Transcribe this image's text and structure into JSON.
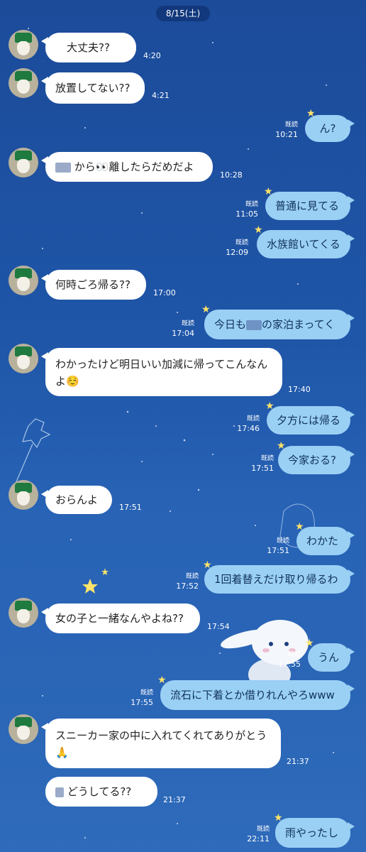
{
  "date": "8/15(土)",
  "read_label": "既読",
  "messages": [
    {
      "side": "in",
      "text": "大丈夫??",
      "time": "4:20"
    },
    {
      "side": "in",
      "text": "放置してない??",
      "time": "4:21"
    },
    {
      "side": "out",
      "text": "ん?",
      "time": "10:21"
    },
    {
      "side": "in",
      "text": "から👀離したらだめだよ",
      "time": "10:28"
    },
    {
      "side": "out",
      "text": "普通に見てる",
      "time": "11:05"
    },
    {
      "side": "out",
      "text": "水族館いてくる",
      "time": "12:09"
    },
    {
      "side": "in",
      "text": "何時ごろ帰る??",
      "time": "17:00"
    },
    {
      "side": "out",
      "text_a": "今日も",
      "text_b": "の家泊まってく",
      "time": "17:04"
    },
    {
      "side": "in",
      "text": "わかったけど明日いい加減に帰ってこんなんよ☺️",
      "time": "17:40"
    },
    {
      "side": "out",
      "text": "夕方には帰る",
      "time": "17:46"
    },
    {
      "side": "out",
      "text": "今家おる?",
      "time": "17:51"
    },
    {
      "side": "in",
      "text": "おらんよ",
      "time": "17:51"
    },
    {
      "side": "out",
      "text": "わかた",
      "time": "17:51"
    },
    {
      "side": "out",
      "text": "1回着替えだけ取り帰るわ",
      "time": "17:52"
    },
    {
      "side": "in",
      "text": "女の子と一緒なんやよね??",
      "time": "17:54"
    },
    {
      "side": "out",
      "text": "うん",
      "time": "17:55"
    },
    {
      "side": "out",
      "text": "流石に下着とか借りれんやろwww",
      "time": "17:55"
    },
    {
      "side": "in",
      "text": "スニーカー家の中に入れてくれてありがとう🙏",
      "time": "21:37"
    },
    {
      "side": "in",
      "text": "どうしてる??",
      "time": "21:37"
    },
    {
      "side": "out",
      "text": "雨やったし",
      "time": "22:11"
    }
  ]
}
